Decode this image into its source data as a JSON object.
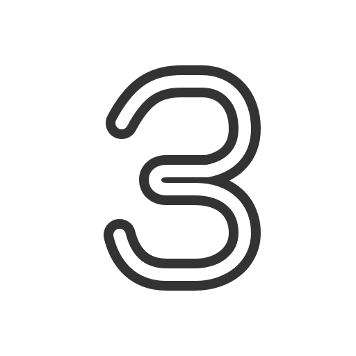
{
  "icon": {
    "name": "number-three-icon",
    "stroke_color": "#333333",
    "fill_color": "#ffffff",
    "background": "#ffffff"
  }
}
